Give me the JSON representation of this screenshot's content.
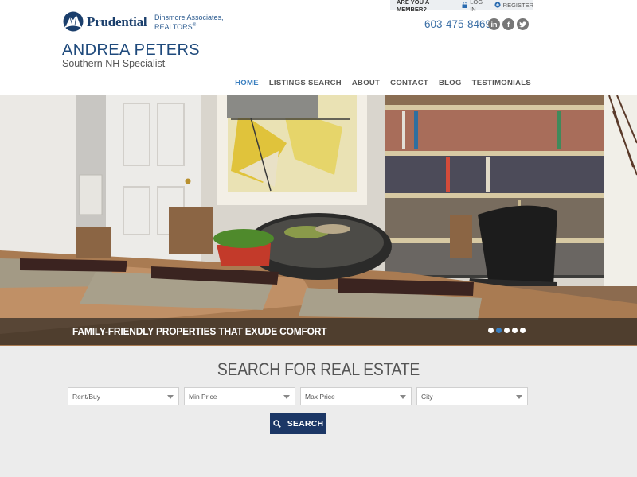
{
  "brand": {
    "name": "Prudential",
    "affiliate_line1": "Dinsmore Associates,",
    "affiliate_line2": "REALTORS",
    "affiliate_mark": "®"
  },
  "agent": {
    "name": "ANDREA PETERS",
    "tagline": "Southern NH Specialist"
  },
  "member_bar": {
    "question": "ARE YOU A MEMBER?",
    "login_label": "LOG IN",
    "register_label": "REGISTER"
  },
  "contact": {
    "phone": "603-475-8469"
  },
  "social": {
    "linkedin": "in",
    "facebook": "f",
    "twitter": "t"
  },
  "nav": {
    "items": [
      {
        "label": "HOME"
      },
      {
        "label": "LISTINGS SEARCH"
      },
      {
        "label": "ABOUT"
      },
      {
        "label": "CONTACT"
      },
      {
        "label": "BLOG"
      },
      {
        "label": "TESTIMONIALS"
      }
    ],
    "active_index": 0
  },
  "hero": {
    "caption": "FAMILY-FRIENDLY PROPERTIES THAT EXUDE COMFORT",
    "slide_count": 5,
    "active_slide": 2
  },
  "search": {
    "title": "SEARCH FOR REAL ESTATE",
    "fields": [
      {
        "label": "Rent/Buy"
      },
      {
        "label": "Min Price"
      },
      {
        "label": "Max Price"
      },
      {
        "label": "City"
      }
    ],
    "button_label": "SEARCH"
  },
  "colors": {
    "brand_blue": "#1f4a7c",
    "accent_blue": "#3a7fc0",
    "button_navy": "#1c3766"
  }
}
